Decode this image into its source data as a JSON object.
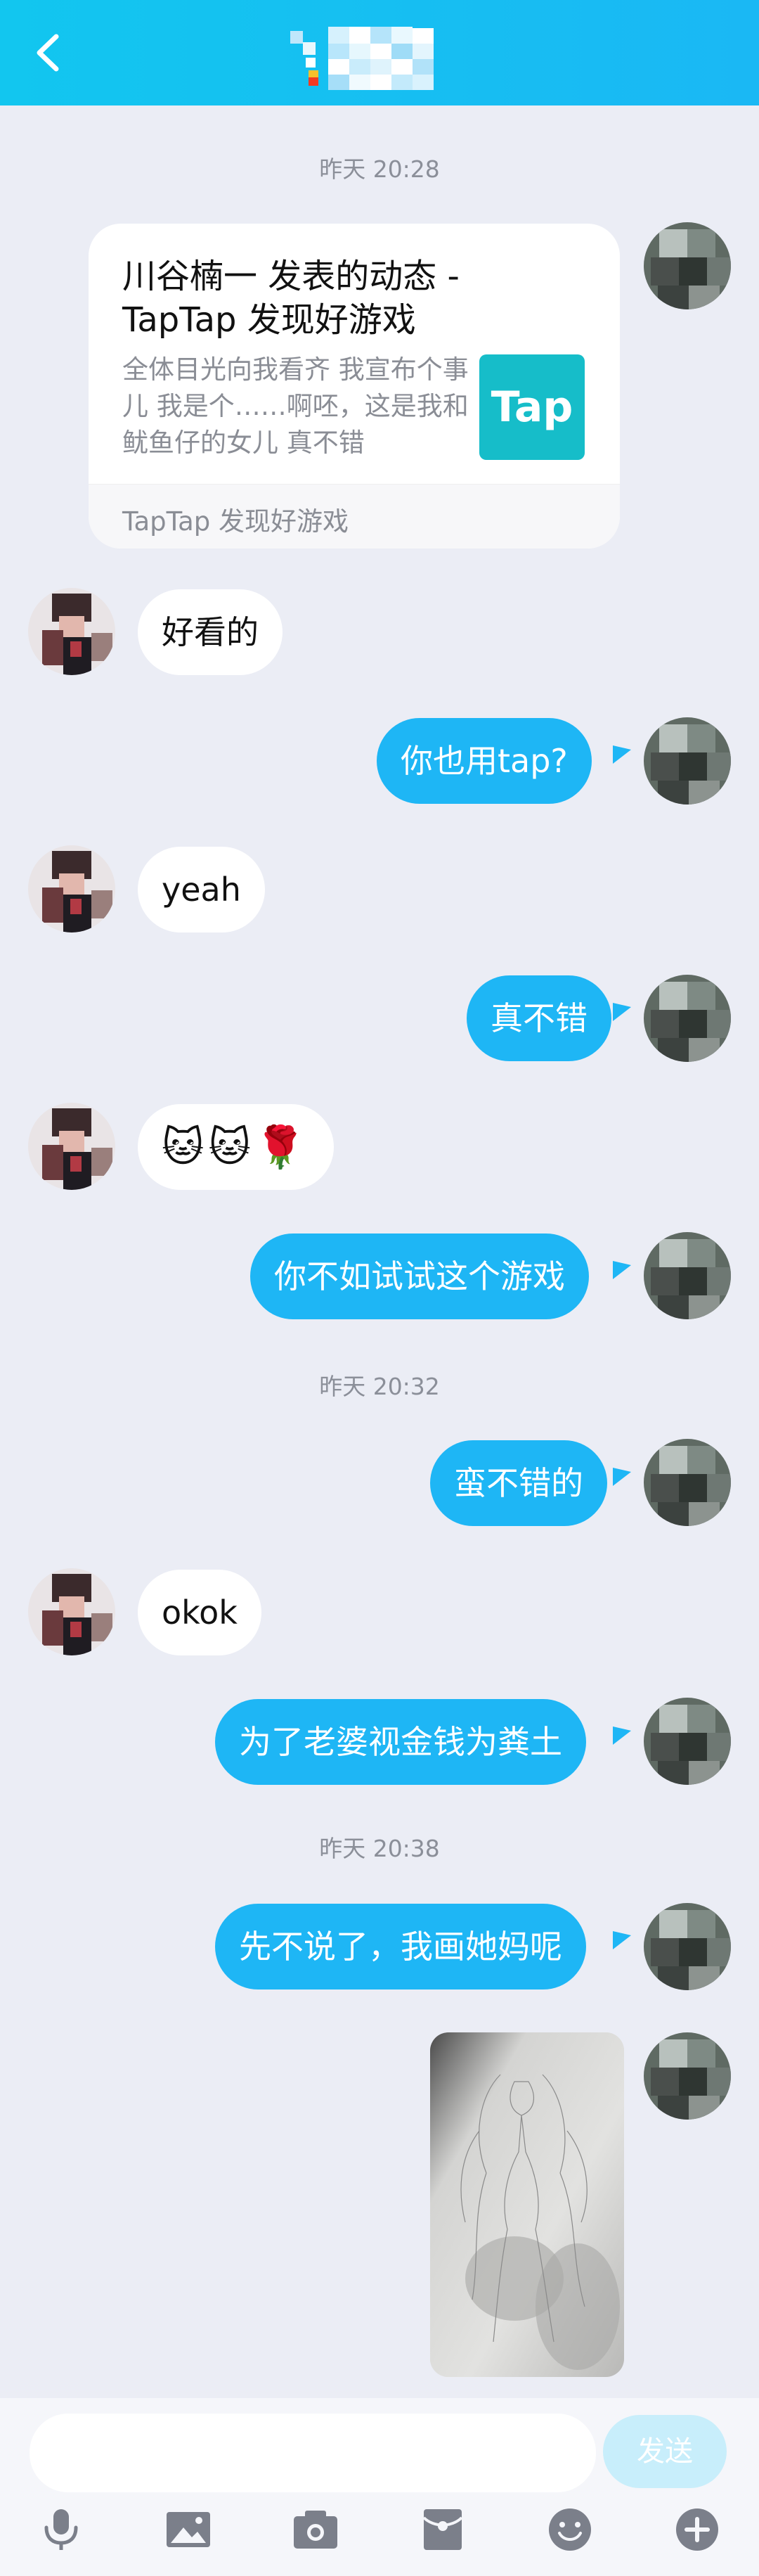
{
  "colors": {
    "topbar": "#12c6ef",
    "bubble_out": "#1eb6f5",
    "bubble_in": "#ffffff",
    "background": "#ebedf5",
    "send_disabled": "#c8eefb"
  },
  "header": {
    "back_icon": "chevron-left-icon"
  },
  "timestamps": [
    "昨天 20:28",
    "昨天 20:32",
    "昨天 20:38"
  ],
  "card": {
    "title": "川谷楠一 发表的动态 - TapTap 发现好游戏",
    "description": "全体目光向我看齐 我宣布个事儿 我是个……啊呸，这是我和鱿鱼仔的女儿 真不错",
    "logo_text": "Tap",
    "source": "TapTap 发现好游戏"
  },
  "messages": {
    "m1": "好看的",
    "m2": "你也用tap?",
    "m3": "yeah",
    "m4": "真不错",
    "m5": "🐱🐱🌹",
    "m6": "你不如试试这个游戏",
    "m7": "蛮不错的",
    "m8": "okok",
    "m9": "为了老婆视金钱为粪土",
    "m10": "先不说了，我画她妈呢"
  },
  "input": {
    "placeholder": "",
    "send_label": "发送"
  },
  "toolbar": [
    "microphone-icon",
    "image-icon",
    "camera-icon",
    "red-packet-icon",
    "emoji-icon",
    "plus-icon"
  ]
}
